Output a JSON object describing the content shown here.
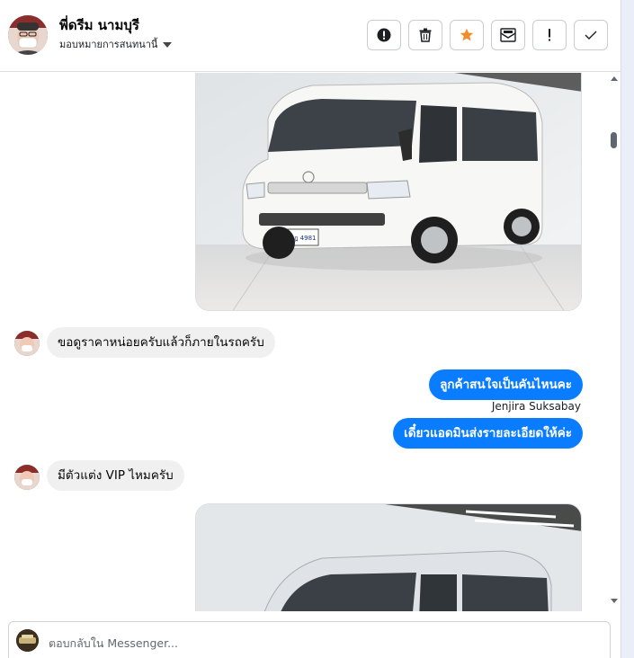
{
  "header": {
    "name": "พี่ดรีม นามบุรี",
    "assignee": "มอบหมายการสนทนานี้",
    "tools": [
      {
        "name": "spam-report-button",
        "icon": "alert-circle-icon"
      },
      {
        "name": "delete-button",
        "icon": "trash-icon"
      },
      {
        "name": "star-button",
        "icon": "star-icon"
      },
      {
        "name": "mark-unread-button",
        "icon": "envelope-icon"
      },
      {
        "name": "follow-up-button",
        "icon": "exclamation-icon"
      },
      {
        "name": "mark-done-button",
        "icon": "check-icon"
      }
    ]
  },
  "messages": [
    {
      "type": "incoming",
      "text": "ขอดูราคาหน่อยครับแล้วก็ภายในรถครับ"
    },
    {
      "type": "outgoing",
      "text": "ลูกค้าสนใจเป็นคันไหนคะ"
    },
    {
      "type": "sender",
      "text": "Jenjira Suksabay"
    },
    {
      "type": "outgoing",
      "text": "เดี๋ยวแอดมินส่งรายละเอียดให้ค่ะ"
    },
    {
      "type": "incoming",
      "text": "มีตัวแต่ง VIP ไหมครับ"
    }
  ],
  "van_plate": "ฮฎ 4981",
  "composer": {
    "placeholder": "ตอบกลับใน Messenger..."
  },
  "colors": {
    "accent": "#0a7cff",
    "star": "#f28c28"
  }
}
